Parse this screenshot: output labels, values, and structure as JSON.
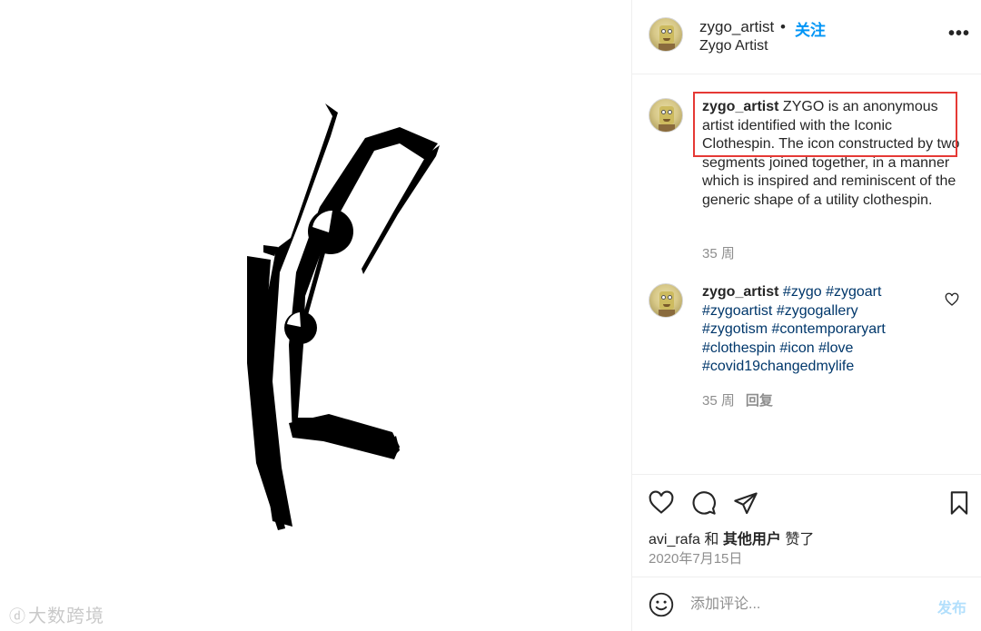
{
  "post": {
    "header": {
      "username": "zygo_artist",
      "separator": "•",
      "follow_label": "关注",
      "location": "Zygo Artist",
      "more_icon": "more-horizontal-icon"
    },
    "caption": {
      "username": "zygo_artist",
      "text": "ZYGO is an anonymous artist identified with the Iconic Clothespin. The icon constructed by two segments joined together, in a manner which is inspired and reminiscent of the generic shape of a utility clothespin.",
      "time": "35 周"
    },
    "comment": {
      "username": "zygo_artist",
      "hashtags": [
        "#zygo",
        "#zygoart",
        "#zygoartist",
        "#zygogallery",
        "#zygotism",
        "#contemporaryart",
        "#clothespin",
        "#icon",
        "#love",
        "#covid19changedmylife"
      ],
      "time": "35 周",
      "reply_label": "回复"
    },
    "likes": {
      "user": "avi_rafa",
      "and": "和",
      "others": "其他用户",
      "suffix": "赞了"
    },
    "date": "2020年7月15日",
    "compose": {
      "placeholder": "添加评论...",
      "post_label": "发布"
    },
    "watermark": "大数跨境",
    "colors": {
      "accent": "#0095f6",
      "hashtag": "#00376b",
      "muted": "#8e8e8e",
      "post_disabled": "#b2dffc",
      "highlight": "#e53935"
    }
  }
}
